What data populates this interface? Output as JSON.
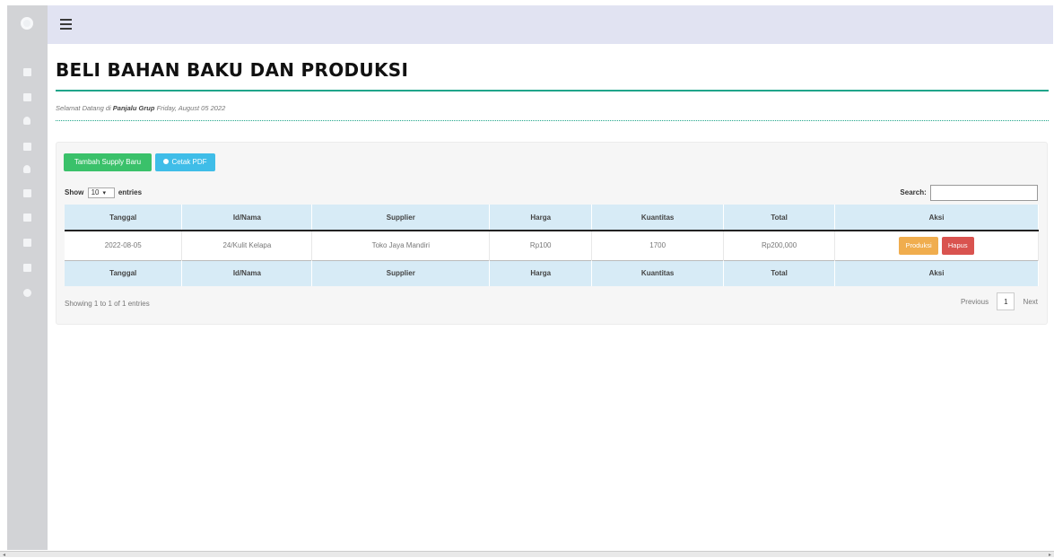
{
  "sidebar": {
    "items": [
      {
        "icon": "dashboard-icon"
      },
      {
        "icon": "list-icon"
      },
      {
        "icon": "user-icon"
      },
      {
        "icon": "lock-icon"
      },
      {
        "icon": "user-icon"
      },
      {
        "icon": "lock-icon"
      },
      {
        "icon": "document-icon"
      },
      {
        "icon": "card-icon"
      },
      {
        "icon": "card-icon"
      },
      {
        "icon": "gear-icon"
      }
    ]
  },
  "header": {
    "title": "BELI BAHAN BAKU DAN PRODUKSI",
    "welcome_prefix": "Selamat Datang di",
    "brand": "Panjalu Grup",
    "date": "Friday, August 05 2022"
  },
  "toolbar": {
    "add_label": "Tambah Supply Baru",
    "pdf_label": "Cetak PDF"
  },
  "table_controls": {
    "show_label": "Show",
    "entries_value": "10",
    "entries_label": "entries",
    "search_label": "Search:",
    "search_value": ""
  },
  "table": {
    "columns": [
      "Tanggal",
      "Id/Nama",
      "Supplier",
      "Harga",
      "Kuantitas",
      "Total",
      "Aksi"
    ],
    "rows": [
      {
        "tanggal": "2022-08-05",
        "id_nama": "24/Kulit Kelapa",
        "supplier": "Toko Jaya Mandiri",
        "harga": "Rp100",
        "kuantitas": "1700",
        "total": "Rp200,000",
        "action_produksi": "Produksi",
        "action_hapus": "Hapus"
      }
    ]
  },
  "footer": {
    "info": "Showing 1 to 1 of 1 entries",
    "previous": "Previous",
    "page": "1",
    "next": "Next"
  },
  "colors": {
    "accent": "#1fa58a",
    "btn_green": "#3ac16a",
    "btn_blue": "#3fbde8",
    "btn_orange": "#f0ad4e",
    "btn_red": "#d9534f",
    "table_header": "#d7ebf6"
  }
}
